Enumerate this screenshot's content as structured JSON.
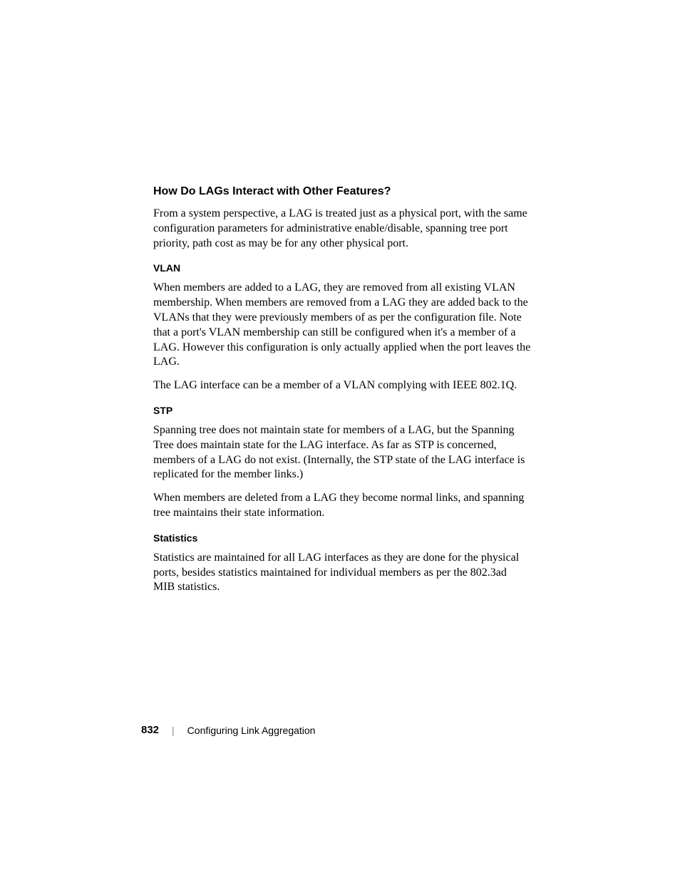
{
  "heading": "How Do LAGs Interact with Other Features?",
  "intro": "From a system perspective, a LAG is treated just as a physical port, with the same configuration parameters for administrative enable/disable, spanning tree port priority, path cost as may be for any other physical port.",
  "sections": {
    "vlan": {
      "title": "VLAN",
      "p1": "When members are added to a LAG, they are removed from all existing VLAN membership. When members are removed from a LAG they are added back to the VLANs that they were previously members of as per the configuration file. Note that a port's VLAN membership can still be configured when it's a member of a LAG. However this configuration is only actually applied when the port leaves the LAG.",
      "p2": "The LAG interface can be a member of a VLAN complying with IEEE 802.1Q."
    },
    "stp": {
      "title": "STP",
      "p1": "Spanning tree does not maintain state for members of a LAG, but the Spanning Tree does maintain state for the LAG interface. As far as STP is concerned, members of a LAG do not exist. (Internally, the STP state of the LAG interface is replicated for the member links.)",
      "p2": "When members are deleted from a LAG they become normal links, and spanning tree maintains their state information."
    },
    "statistics": {
      "title": "Statistics",
      "p1": "Statistics are maintained for all LAG interfaces as they are done for the physical ports, besides statistics maintained for individual members as per the 802.3ad MIB statistics."
    }
  },
  "footer": {
    "page_number": "832",
    "divider": "|",
    "title": "Configuring Link Aggregation"
  }
}
